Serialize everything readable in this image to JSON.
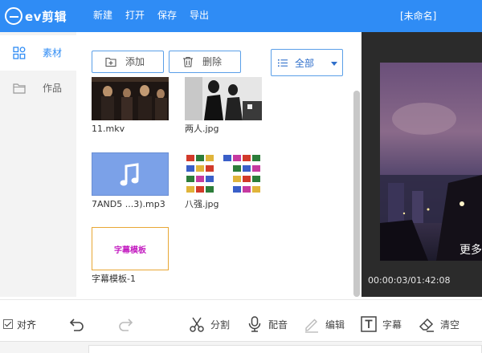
{
  "app": {
    "logo_text": "ev剪辑",
    "document_title": "[未命名]"
  },
  "menu": [
    {
      "label": "新建"
    },
    {
      "label": "打开"
    },
    {
      "label": "保存"
    },
    {
      "label": "导出"
    }
  ],
  "sidebar": {
    "items": [
      {
        "label": "素材",
        "icon": "grid-icon",
        "active": true
      },
      {
        "label": "作品",
        "icon": "folder-icon",
        "active": false
      }
    ]
  },
  "media": {
    "add_label": "添加",
    "delete_label": "删除",
    "filter": {
      "selected": "全部"
    },
    "items": [
      {
        "name": "11.mkv",
        "kind": "video"
      },
      {
        "name": "两人.jpg",
        "kind": "image"
      },
      {
        "name": "7AND5 ...3).mp3",
        "kind": "audio"
      },
      {
        "name": "八强.jpg",
        "kind": "image"
      },
      {
        "name": "字幕模板-1",
        "kind": "text-template",
        "thumb_text": "字幕模板"
      }
    ]
  },
  "preview": {
    "caption": "更多",
    "timecode": "00:00:03/01:42:08"
  },
  "toolbar": {
    "align_label": "对齐",
    "align_checked": true,
    "split_label": "分割",
    "dub_label": "配音",
    "edit_label": "编辑",
    "subtitle_label": "字幕",
    "clear_label": "清空"
  },
  "colors": {
    "accent": "#2f8cf5",
    "text_template": "#c41fc1",
    "template_border": "#e8a735",
    "audio_thumb": "#7ba1e8"
  }
}
